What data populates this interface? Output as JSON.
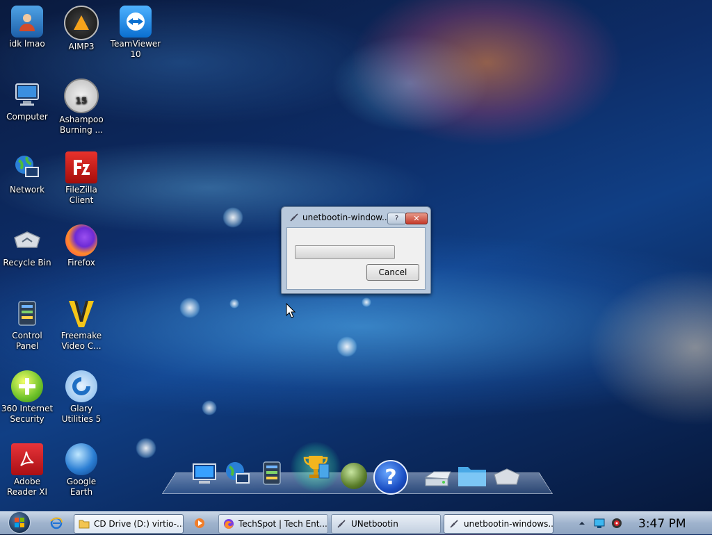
{
  "desktop": {
    "icons": [
      {
        "label": "idk lmao"
      },
      {
        "label": "AIMP3"
      },
      {
        "label": "TeamViewer 10"
      },
      {
        "label": "Computer"
      },
      {
        "label": "Ashampoo Burning ..."
      },
      {
        "label": "Network"
      },
      {
        "label": "FileZilla Client"
      },
      {
        "label": "Recycle Bin"
      },
      {
        "label": "Firefox"
      },
      {
        "label": "Control Panel"
      },
      {
        "label": "Freemake Video C..."
      },
      {
        "label": "360 Internet Security"
      },
      {
        "label": "Glary Utilities 5"
      },
      {
        "label": "Adobe Reader XI"
      },
      {
        "label": "Google Earth"
      }
    ],
    "ashampoo_badge": "15"
  },
  "dialog": {
    "title": "unetbootin-window...",
    "help_label": "?",
    "close_label": "✕",
    "cancel_label": "Cancel",
    "progress_fraction": 0
  },
  "dock": {
    "help_glyph": "?"
  },
  "taskbar": {
    "buttons": [
      {
        "label": "CD Drive (D:) virtio-..."
      },
      {
        "label": "TechSpot | Tech Ent..."
      },
      {
        "label": "UNetbootin"
      },
      {
        "label": "unetbootin-windows..."
      }
    ],
    "clock": "3:47 PM"
  },
  "colors": {
    "taskbar": "#9fb3cd",
    "dialog_frame": "#b9c9dc",
    "close_red": "#c4392a"
  }
}
